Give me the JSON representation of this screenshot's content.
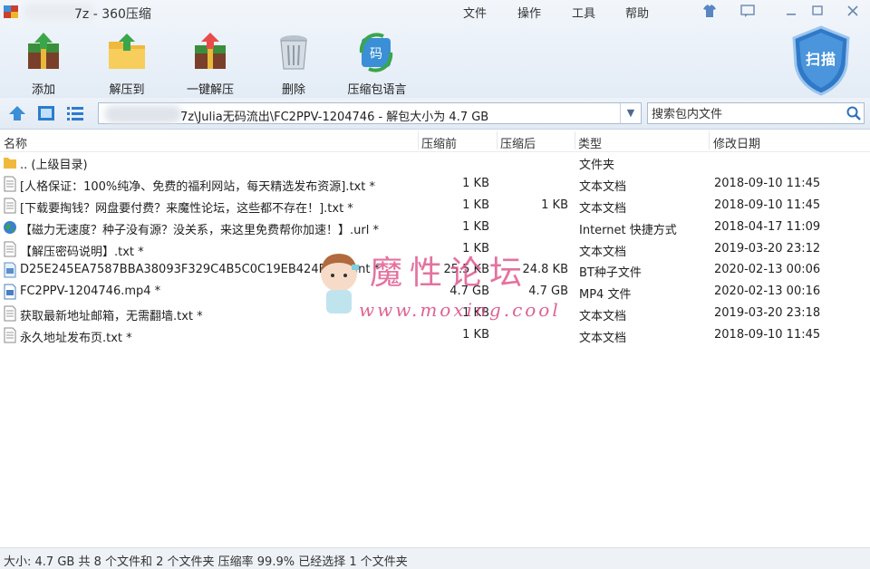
{
  "window": {
    "title": "7z - 360压缩"
  },
  "menu": [
    "文件",
    "操作",
    "工具",
    "帮助"
  ],
  "toolbar": {
    "add": "添加",
    "extract_to": "解压到",
    "one_click": "一键解压",
    "delete": "删除",
    "language": "压缩包语言"
  },
  "scan_badge": {
    "label": "扫描"
  },
  "address": {
    "path": "7z\\Julia无码流出\\FC2PPV-1204746 - 解包大小为 4.7 GB"
  },
  "search": {
    "placeholder": "搜索包内文件"
  },
  "columns": {
    "name": "名称",
    "packed": "压缩前",
    "original": "压缩后",
    "type": "类型",
    "modified": "修改日期"
  },
  "files": [
    {
      "name": ".. (上级目录)",
      "packed": "",
      "original": "",
      "type": "文件夹",
      "date": "",
      "icon": "folder-icon"
    },
    {
      "name": "[人格保证：100%纯净、免费的福利网站，每天精选发布资源].txt *",
      "packed": "1 KB",
      "original": "",
      "type": "文本文档",
      "date": "2018-09-10 11:45",
      "icon": "text-file-icon"
    },
    {
      "name": "[下载要掏钱？网盘要付费？来魔性论坛，这些都不存在！].txt *",
      "packed": "1 KB",
      "original": "1 KB",
      "type": "文本文档",
      "date": "2018-09-10 11:45",
      "icon": "text-file-icon"
    },
    {
      "name": "【磁力无速度？种子没有源？没关系，来这里免费帮你加速！】.url *",
      "packed": "1 KB",
      "original": "",
      "type": "Internet 快捷方式",
      "date": "2018-04-17 11:09",
      "icon": "globe-icon"
    },
    {
      "name": "【解压密码说明】.txt *",
      "packed": "1 KB",
      "original": "",
      "type": "文本文档",
      "date": "2019-03-20 23:12",
      "icon": "text-file-icon"
    },
    {
      "name": "D25E245EA7587BBA38093F329C4B5C0C19EB424E.torrent *",
      "packed": "25.5 KB",
      "original": "24.8 KB",
      "type": "BT种子文件",
      "date": "2020-02-13 00:06",
      "icon": "torrent-file-icon"
    },
    {
      "name": "FC2PPV-1204746.mp4 *",
      "packed": "4.7 GB",
      "original": "4.7 GB",
      "type": "MP4 文件",
      "date": "2020-02-13 00:16",
      "icon": "video-file-icon"
    },
    {
      "name": "获取最新地址邮箱，无需翻墙.txt *",
      "packed": "1 KB",
      "original": "",
      "type": "文本文档",
      "date": "2019-03-20 23:18",
      "icon": "text-file-icon"
    },
    {
      "name": "永久地址发布页.txt *",
      "packed": "1 KB",
      "original": "",
      "type": "文本文档",
      "date": "2018-09-10 11:45",
      "icon": "text-file-icon"
    }
  ],
  "watermark": {
    "title": "魔性论坛",
    "url": "www.moxing.cool"
  },
  "status": {
    "text": "大小: 4.7 GB 共 8 个文件和 2 个文件夹 压缩率 99.9% 已经选择 1 个文件夹"
  }
}
